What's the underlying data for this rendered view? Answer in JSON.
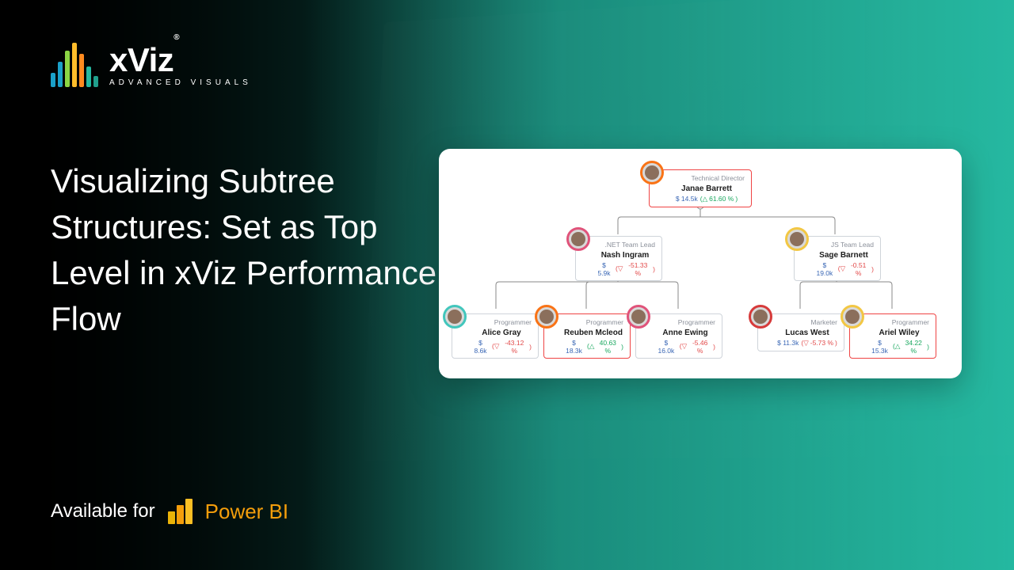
{
  "logo": {
    "brand": "xViz",
    "reg": "®",
    "sub": "ADVANCED  VISUALS"
  },
  "heading": "Visualizing Subtree Structures: Set as Top Level in xViz Performance Flow",
  "footer": {
    "available": "Available for",
    "product": "Power BI"
  },
  "tree": {
    "root": {
      "name": "Janae Barrett",
      "role": "Technical Director",
      "amount": "$ 14.5k",
      "delta": "61.60 %",
      "direction": "up",
      "avatar_color": "#f97316"
    },
    "net": {
      "name": "Nash Ingram",
      "role": ".NET Team Lead",
      "amount": "$ 5.9k",
      "delta": "-51.33 %",
      "direction": "down",
      "avatar_color": "#e0537a"
    },
    "js": {
      "name": "Sage Barnett",
      "role": "JS Team Lead",
      "amount": "$ 19.0k",
      "delta": "-0.51 %",
      "direction": "down",
      "avatar_color": "#f2c744"
    },
    "alice": {
      "name": "Alice Gray",
      "role": "Programmer",
      "amount": "$ 8.6k",
      "delta": "-43.12 %",
      "direction": "down",
      "avatar_color": "#42c6bc"
    },
    "reuben": {
      "name": "Reuben Mcleod",
      "role": "Programmer",
      "amount": "$ 18.3k",
      "delta": "40.63 %",
      "direction": "up",
      "avatar_color": "#f97316"
    },
    "anne": {
      "name": "Anne Ewing",
      "role": "Programmer",
      "amount": "$ 16.0k",
      "delta": "-5.46 %",
      "direction": "down",
      "avatar_color": "#e0537a"
    },
    "lucas": {
      "name": "Lucas West",
      "role": "Marketer",
      "amount": "$ 11.3k",
      "delta": "-5.73 %",
      "direction": "down",
      "avatar_color": "#d63a3a"
    },
    "ariel": {
      "name": "Ariel Wiley",
      "role": "Programmer",
      "amount": "$ 15.3k",
      "delta": "34.22 %",
      "direction": "up",
      "avatar_color": "#f2c744"
    }
  }
}
